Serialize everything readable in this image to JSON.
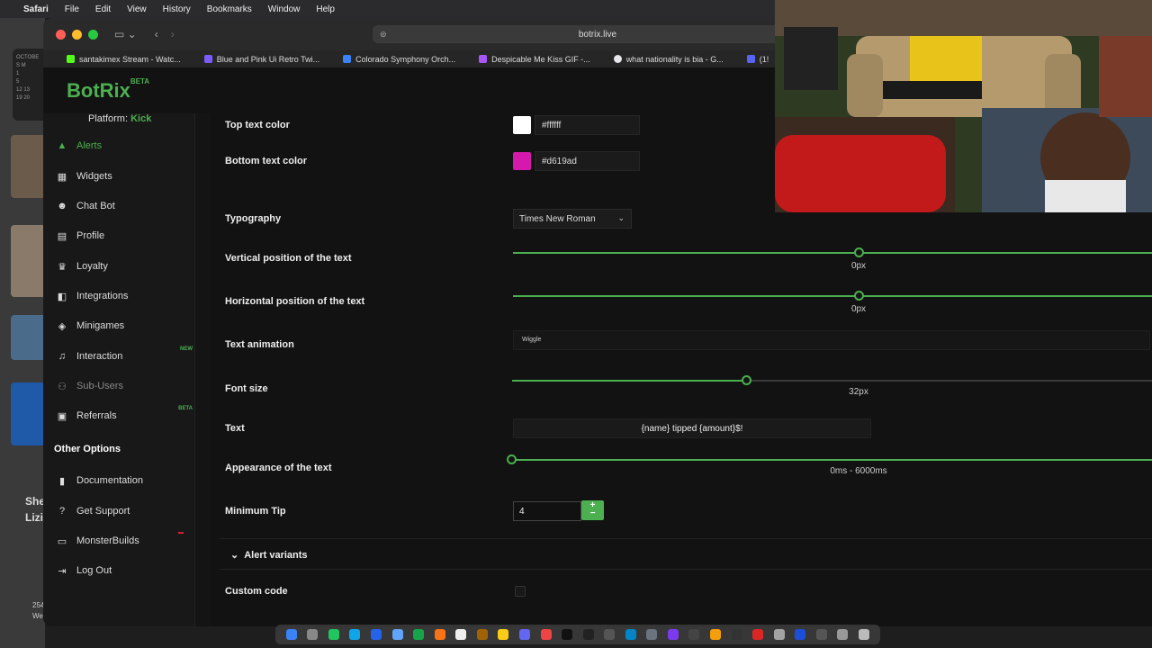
{
  "menubar": {
    "app": "Safari",
    "items": [
      "File",
      "Edit",
      "View",
      "History",
      "Bookmarks",
      "Window",
      "Help"
    ]
  },
  "desktop": {
    "calendar_month": "OCTOBE",
    "calendar_rows": [
      "S M",
      "1",
      "5",
      "12 13",
      "19 20"
    ],
    "left_text_1": "She",
    "left_text_2": "Lizi",
    "left_text_3": "254",
    "left_text_4": "We"
  },
  "browser": {
    "url": "botrix.live",
    "bookmarks": [
      {
        "label": "santakimex Stream - Watc...",
        "color": "#53fc18"
      },
      {
        "label": "Blue and Pink Ui Retro Twi...",
        "color": "#7c5cff"
      },
      {
        "label": "Colorado Symphony Orch...",
        "color": "#3b82f6"
      },
      {
        "label": "Despicable Me Kiss GIF -...",
        "color": "#a855f7"
      },
      {
        "label": "what nationality is bia - G...",
        "color": "#e5e7eb"
      },
      {
        "label": "(1!",
        "color": "#5865f2"
      }
    ]
  },
  "app": {
    "logo": "BotRix",
    "logo_badge": "BETA",
    "platform_label": "Platform:",
    "platform_value": "Kick"
  },
  "sidebar": {
    "items": [
      {
        "label": "Alerts",
        "icon": "warning-icon"
      },
      {
        "label": "Widgets",
        "icon": "grid-icon"
      },
      {
        "label": "Chat Bot",
        "icon": "robot-icon"
      },
      {
        "label": "Profile",
        "icon": "id-card-icon"
      },
      {
        "label": "Loyalty",
        "icon": "trophy-icon"
      },
      {
        "label": "Integrations",
        "icon": "integration-icon"
      },
      {
        "label": "Minigames",
        "icon": "gamepad-icon"
      },
      {
        "label": "Interaction",
        "icon": "music-icon",
        "badge": "NEW"
      },
      {
        "label": "Sub-Users",
        "icon": "users-icon"
      },
      {
        "label": "Referrals",
        "icon": "referral-icon",
        "badge": "BETA"
      }
    ],
    "other_heading": "Other Options",
    "other_items": [
      {
        "label": "Documentation",
        "icon": "book-icon"
      },
      {
        "label": "Get Support",
        "icon": "help-icon"
      },
      {
        "label": "MonsterBuilds",
        "icon": "laptop-icon"
      },
      {
        "label": "Log Out",
        "icon": "logout-icon"
      }
    ]
  },
  "settings": {
    "top_text_color": {
      "label": "Top text color",
      "value": "#ffffff",
      "color": "#ffffff"
    },
    "bottom_text_color": {
      "label": "Bottom text color",
      "value": "#d619ad",
      "color": "#d619ad"
    },
    "typography": {
      "label": "Typography",
      "value": "Times New Roman"
    },
    "vertical_position": {
      "label": "Vertical position of the text",
      "value": "0px"
    },
    "horizontal_position": {
      "label": "Horizontal position of the text",
      "value": "0px"
    },
    "text_animation": {
      "label": "Text animation",
      "value": "Wiggle"
    },
    "font_size": {
      "label": "Font size",
      "value": "32px"
    },
    "text": {
      "label": "Text",
      "value": "{name} tipped {amount}$!"
    },
    "appearance": {
      "label": "Appearance of the text",
      "value": "0ms - 6000ms"
    },
    "minimum_tip": {
      "label": "Minimum Tip",
      "value": "4",
      "plus": "+",
      "minus": "−"
    },
    "alert_variants": "Alert variants",
    "custom_code": {
      "label": "Custom code"
    }
  }
}
